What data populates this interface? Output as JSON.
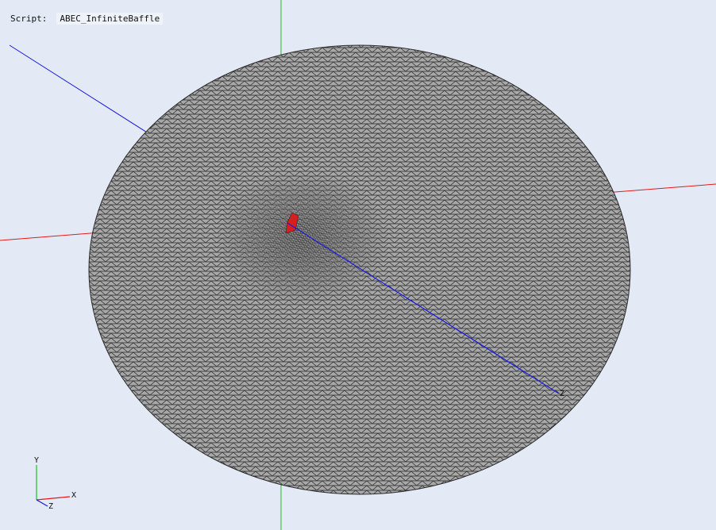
{
  "script": {
    "label": "Script:",
    "value": "ABEC_InfiniteBaffle"
  },
  "axes_triad": {
    "x_label": "X",
    "y_label": "Y",
    "z_label": "Z"
  },
  "scene_axes": {
    "z_end_label": "Z"
  },
  "colors": {
    "background": "#e3eaf5",
    "mesh_fill": "#a8a8a8",
    "mesh_lines": "#2a2a2a",
    "axis_x": "#e31a1a",
    "axis_y": "#1ac21a",
    "axis_z": "#1a1ae0",
    "source_element": "#d42020"
  },
  "icons": {
    "triad": "xyz-axes-triad-icon"
  }
}
